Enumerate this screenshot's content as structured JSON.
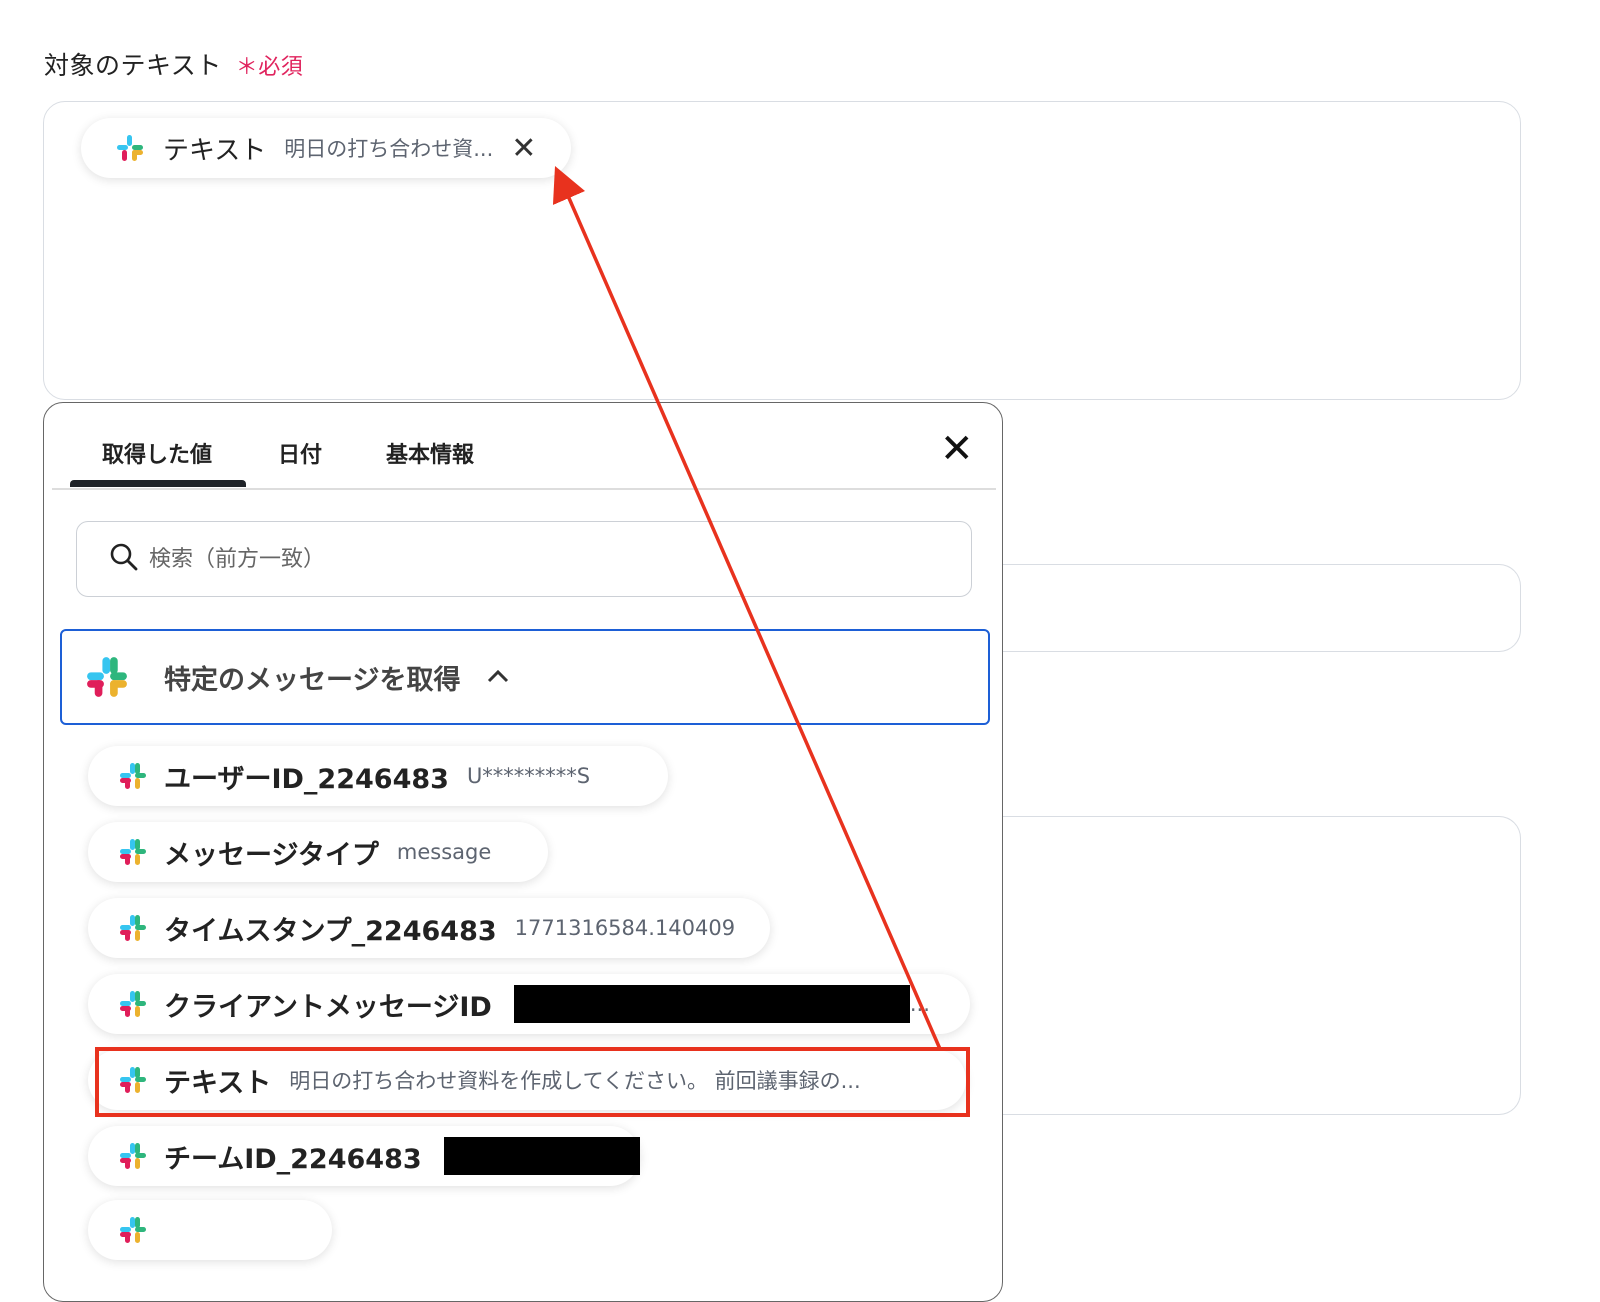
{
  "field": {
    "label": "対象のテキスト",
    "required": "＊必須"
  },
  "selected_chip": {
    "name": "テキスト",
    "value": "明日の打ち合わせ資...",
    "close": "✕",
    "icon": "slack-icon"
  },
  "picker": {
    "tabs": [
      "取得した値",
      "日付",
      "基本情報"
    ],
    "active_tab": "取得した値",
    "close": "✕",
    "search_placeholder": "検索（前方一致）",
    "group": {
      "name": "特定のメッセージを取得",
      "chevron": "^"
    },
    "items": [
      {
        "name": "ユーザーID_2246483",
        "value": "U*********S"
      },
      {
        "name": "メッセージタイプ",
        "value": "message"
      },
      {
        "name": "タイムスタンプ_2246483",
        "value": "1771316584.140409"
      },
      {
        "name": "クライアントメッセージID",
        "value": "",
        "redacted": true,
        "suffix": "..."
      },
      {
        "name": "テキスト",
        "value": "明日の打ち合わせ資料を作成してください。 前回議事録の..."
      },
      {
        "name": "チームID_2246483",
        "value": "",
        "redacted": true
      },
      {
        "name": "",
        "value": ""
      }
    ]
  },
  "colors": {
    "required": "#e0245e",
    "focus_border": "#1d5fd6",
    "annotation": "#e8321e"
  }
}
